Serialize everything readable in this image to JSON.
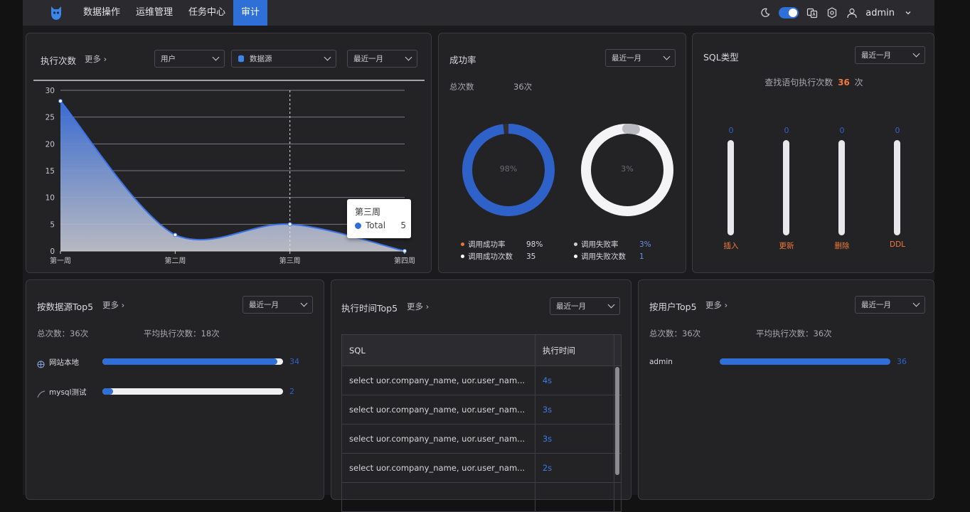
{
  "nav": {
    "items": [
      "数据操作",
      "运维管理",
      "任务中心",
      "审计"
    ],
    "active_index": 3,
    "user": "admin"
  },
  "exec_panel": {
    "title": "执行次数",
    "more": "更多",
    "user_select": "用户",
    "source_select": "数据源",
    "period_select": "最近一月",
    "tooltip": {
      "title": "第三周",
      "series": "Total",
      "value": "5"
    }
  },
  "chart_data": {
    "type": "area",
    "categories": [
      "第一周",
      "第二周",
      "第三周",
      "第四周"
    ],
    "series": [
      {
        "name": "Total",
        "values": [
          28,
          3,
          5,
          0
        ]
      }
    ],
    "ylim": [
      0,
      30
    ],
    "yticks": [
      0,
      5,
      10,
      15,
      20,
      25,
      30
    ],
    "grid": true,
    "color": "#3b6fd9"
  },
  "success_panel": {
    "title": "成功率",
    "period_select": "最近一月",
    "total_label": "总次数",
    "total_value": "36次",
    "success_pct": "98%",
    "fail_pct": "3%",
    "success_fraction": 0.98,
    "fail_fraction": 0.03,
    "legend": [
      {
        "label": "调用成功率",
        "value": "98%",
        "color": "#e8773e"
      },
      {
        "label": "调用成功次数",
        "value": "35",
        "color": "#ffffff"
      },
      {
        "label": "调用失败率",
        "value": "3%",
        "color": "#d0d0d4"
      },
      {
        "label": "调用失败次数",
        "value": "1",
        "color": "#ffffff"
      }
    ]
  },
  "sql_panel": {
    "title": "SQL类型",
    "period_select": "最近一月",
    "query_label": "查找语句执行次数",
    "query_count": "36",
    "query_unit": "次",
    "types": [
      {
        "label": "插入",
        "value": "0"
      },
      {
        "label": "更新",
        "value": "0"
      },
      {
        "label": "删除",
        "value": "0"
      },
      {
        "label": "DDL",
        "value": "0"
      }
    ]
  },
  "source_panel": {
    "title": "按数据源Top5",
    "more": "更多",
    "period_select": "最近一月",
    "total": "总次数：36次",
    "avg": "平均执行次数：18次",
    "rows": [
      {
        "name": "网站本地",
        "value": "34",
        "fraction": 0.97
      },
      {
        "name": "mysql测试",
        "value": "2",
        "fraction": 0.06
      }
    ]
  },
  "time_panel": {
    "title": "执行时间Top5",
    "more": "更多",
    "period_select": "最近一月",
    "columns": [
      "SQL",
      "执行时间"
    ],
    "rows": [
      {
        "sql": "select uor.company_name, uor.user_nam...",
        "time": "4s"
      },
      {
        "sql": "select uor.company_name, uor.user_nam...",
        "time": "3s"
      },
      {
        "sql": "select uor.company_name, uor.user_nam...",
        "time": "3s"
      },
      {
        "sql": "select uor.company_name, uor.user_nam...",
        "time": "2s"
      }
    ]
  },
  "user_panel": {
    "title": "按用户Top5",
    "more": "更多",
    "period_select": "最近一月",
    "total": "总次数：36次",
    "avg": "平均执行次数：36次",
    "rows": [
      {
        "name": "admin",
        "value": "36",
        "fraction": 1.0
      }
    ]
  }
}
